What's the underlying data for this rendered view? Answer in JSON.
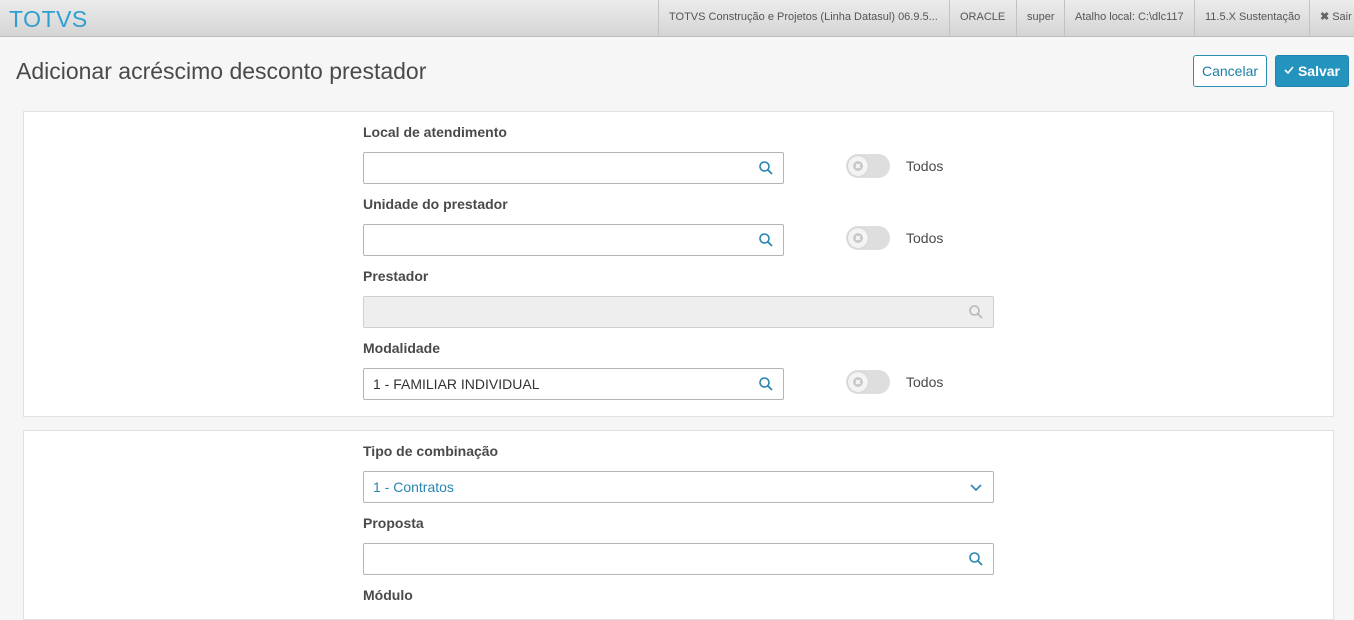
{
  "topbar": {
    "logo": "TOTVS",
    "product": "TOTVS Construção e Projetos (Linha Datasul) 06.9.5...",
    "database": "ORACLE",
    "user": "super",
    "shortcut": "Atalho local: C:\\dlc117",
    "version": "11.5.X Sustentação",
    "exit": "Sair"
  },
  "page": {
    "title": "Adicionar acréscimo desconto prestador",
    "cancel_label": "Cancelar",
    "save_label": "Salvar"
  },
  "section1": {
    "local": {
      "label": "Local de atendimento",
      "value": "",
      "toggle_label": "Todos",
      "toggle_on": false
    },
    "unidade": {
      "label": "Unidade do prestador",
      "value": "",
      "toggle_label": "Todos",
      "toggle_on": false
    },
    "prestador": {
      "label": "Prestador",
      "value": "",
      "disabled": true
    },
    "modalidade": {
      "label": "Modalidade",
      "value": "1 - FAMILIAR INDIVIDUAL",
      "toggle_label": "Todos",
      "toggle_on": false
    }
  },
  "section2": {
    "tipo": {
      "label": "Tipo de combinação",
      "value": "1 - Contratos"
    },
    "proposta": {
      "label": "Proposta",
      "value": ""
    },
    "modulo": {
      "label": "Módulo"
    }
  },
  "icons": {
    "search": "search-icon",
    "chevron": "chevron-down-icon",
    "toggle_off": "x-icon",
    "check": "check-icon",
    "close": "close-icon"
  },
  "colors": {
    "accent": "#2494bf",
    "logo": "#2e9fd1",
    "search_icon": "#2a86b0",
    "disabled_bg": "#eeeeee"
  }
}
